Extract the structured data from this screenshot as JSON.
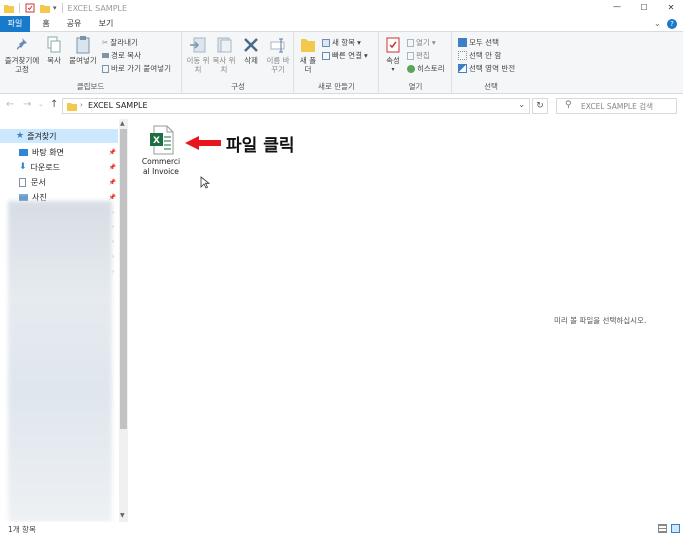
{
  "window": {
    "title": "EXCEL SAMPLE"
  },
  "tabs": [
    {
      "label": "파일",
      "active": true
    },
    {
      "label": "홈",
      "active": false
    },
    {
      "label": "공유",
      "active": false
    },
    {
      "label": "보기",
      "active": false
    }
  ],
  "ribbon": {
    "clipboard": {
      "pin_label": "즐겨찾기에 고정",
      "copy_label": "복사",
      "paste_label": "붙여넣기",
      "cut_label": "잘라내기",
      "copy_path_label": "경로 복사",
      "paste_shortcut_label": "바로 가기 붙여넣기",
      "group_label": "클립보드"
    },
    "organize": {
      "move_label": "이동 위치",
      "copy_to_label": "복사 위치",
      "delete_label": "삭제",
      "rename_label": "이름 바꾸기",
      "group_label": "구성"
    },
    "new": {
      "new_folder_label": "새 폴더",
      "new_item_label": "새 항목",
      "easy_access_label": "빠른 연결",
      "group_label": "새로 만들기"
    },
    "open": {
      "properties_label": "속성",
      "open_label": "열기",
      "edit_label": "편집",
      "history_label": "히스토리",
      "group_label": "열기"
    },
    "select": {
      "select_all_label": "모두 선택",
      "select_none_label": "선택 안 함",
      "invert_label": "선택 영역 반전",
      "group_label": "선택"
    }
  },
  "address": {
    "path": "EXCEL SAMPLE",
    "search_placeholder": "EXCEL SAMPLE 검색"
  },
  "nav": {
    "quick_access": "즐겨찾기",
    "items": [
      {
        "label": "바탕 화면",
        "icon": "desktop-icon"
      },
      {
        "label": "다운로드",
        "icon": "download-icon"
      },
      {
        "label": "문서",
        "icon": "document-icon"
      },
      {
        "label": "사진",
        "icon": "picture-icon"
      }
    ]
  },
  "files": [
    {
      "name": "Commerci\nal Invoice",
      "icon": "excel-file-icon"
    }
  ],
  "annotation": {
    "text": "파일 클릭",
    "color": "#e8141e"
  },
  "preview": {
    "text": "미리 볼 파일을 선택하십시오."
  },
  "status": {
    "count": "1개 항목"
  },
  "colors": {
    "accent": "#1979ca",
    "excel": "#1d6f42"
  }
}
